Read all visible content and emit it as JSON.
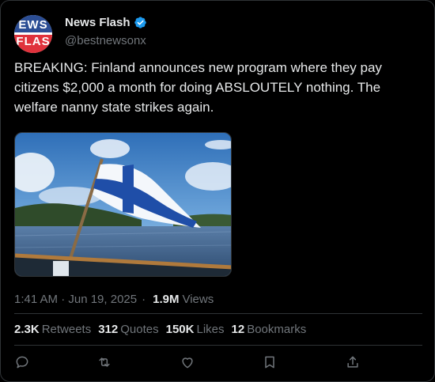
{
  "author": {
    "name": "News Flash",
    "handle": "@bestnewsonx",
    "avatar_top": "EWS",
    "avatar_bottom": "FLAS"
  },
  "tweet": {
    "text": "BREAKING: Finland announces new program where they pay citizens $2,000 a month for doing ABSLOUTELY nothing. The welfare nanny state strikes again."
  },
  "meta": {
    "timestamp": "1:41 AM · Jun 19, 2025",
    "separator": "·",
    "views_count": "1.9M",
    "views_label": "Views"
  },
  "stats": [
    {
      "count": "2.3K",
      "label": "Retweets"
    },
    {
      "count": "312",
      "label": "Quotes"
    },
    {
      "count": "150K",
      "label": "Likes"
    },
    {
      "count": "12",
      "label": "Bookmarks"
    }
  ],
  "icons": {
    "verified": "verified-badge-icon",
    "reply": "reply-icon",
    "retweet": "retweet-icon",
    "like": "heart-icon",
    "bookmark": "bookmark-icon",
    "share": "share-icon"
  },
  "colors": {
    "background": "#000000",
    "text": "#e7e9ea",
    "muted": "#71767b",
    "border": "#2f3336",
    "verified": "#1d9bf0"
  }
}
